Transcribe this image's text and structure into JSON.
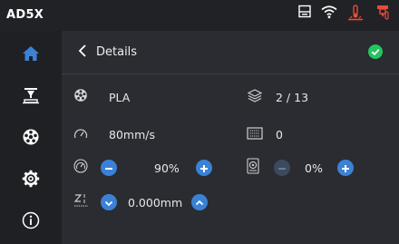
{
  "topbar": {
    "brand": "AD5X"
  },
  "details": {
    "title": "Details",
    "material": "PLA",
    "layers": "2 / 13",
    "speed": "80mm/s",
    "fan": "0",
    "speed_percent": "90%",
    "fan_percent": "0%",
    "z_offset": "0.000mm"
  },
  "colors": {
    "accent": "#3b82d6",
    "ok": "#22c55e",
    "alert": "#e74c3c"
  }
}
